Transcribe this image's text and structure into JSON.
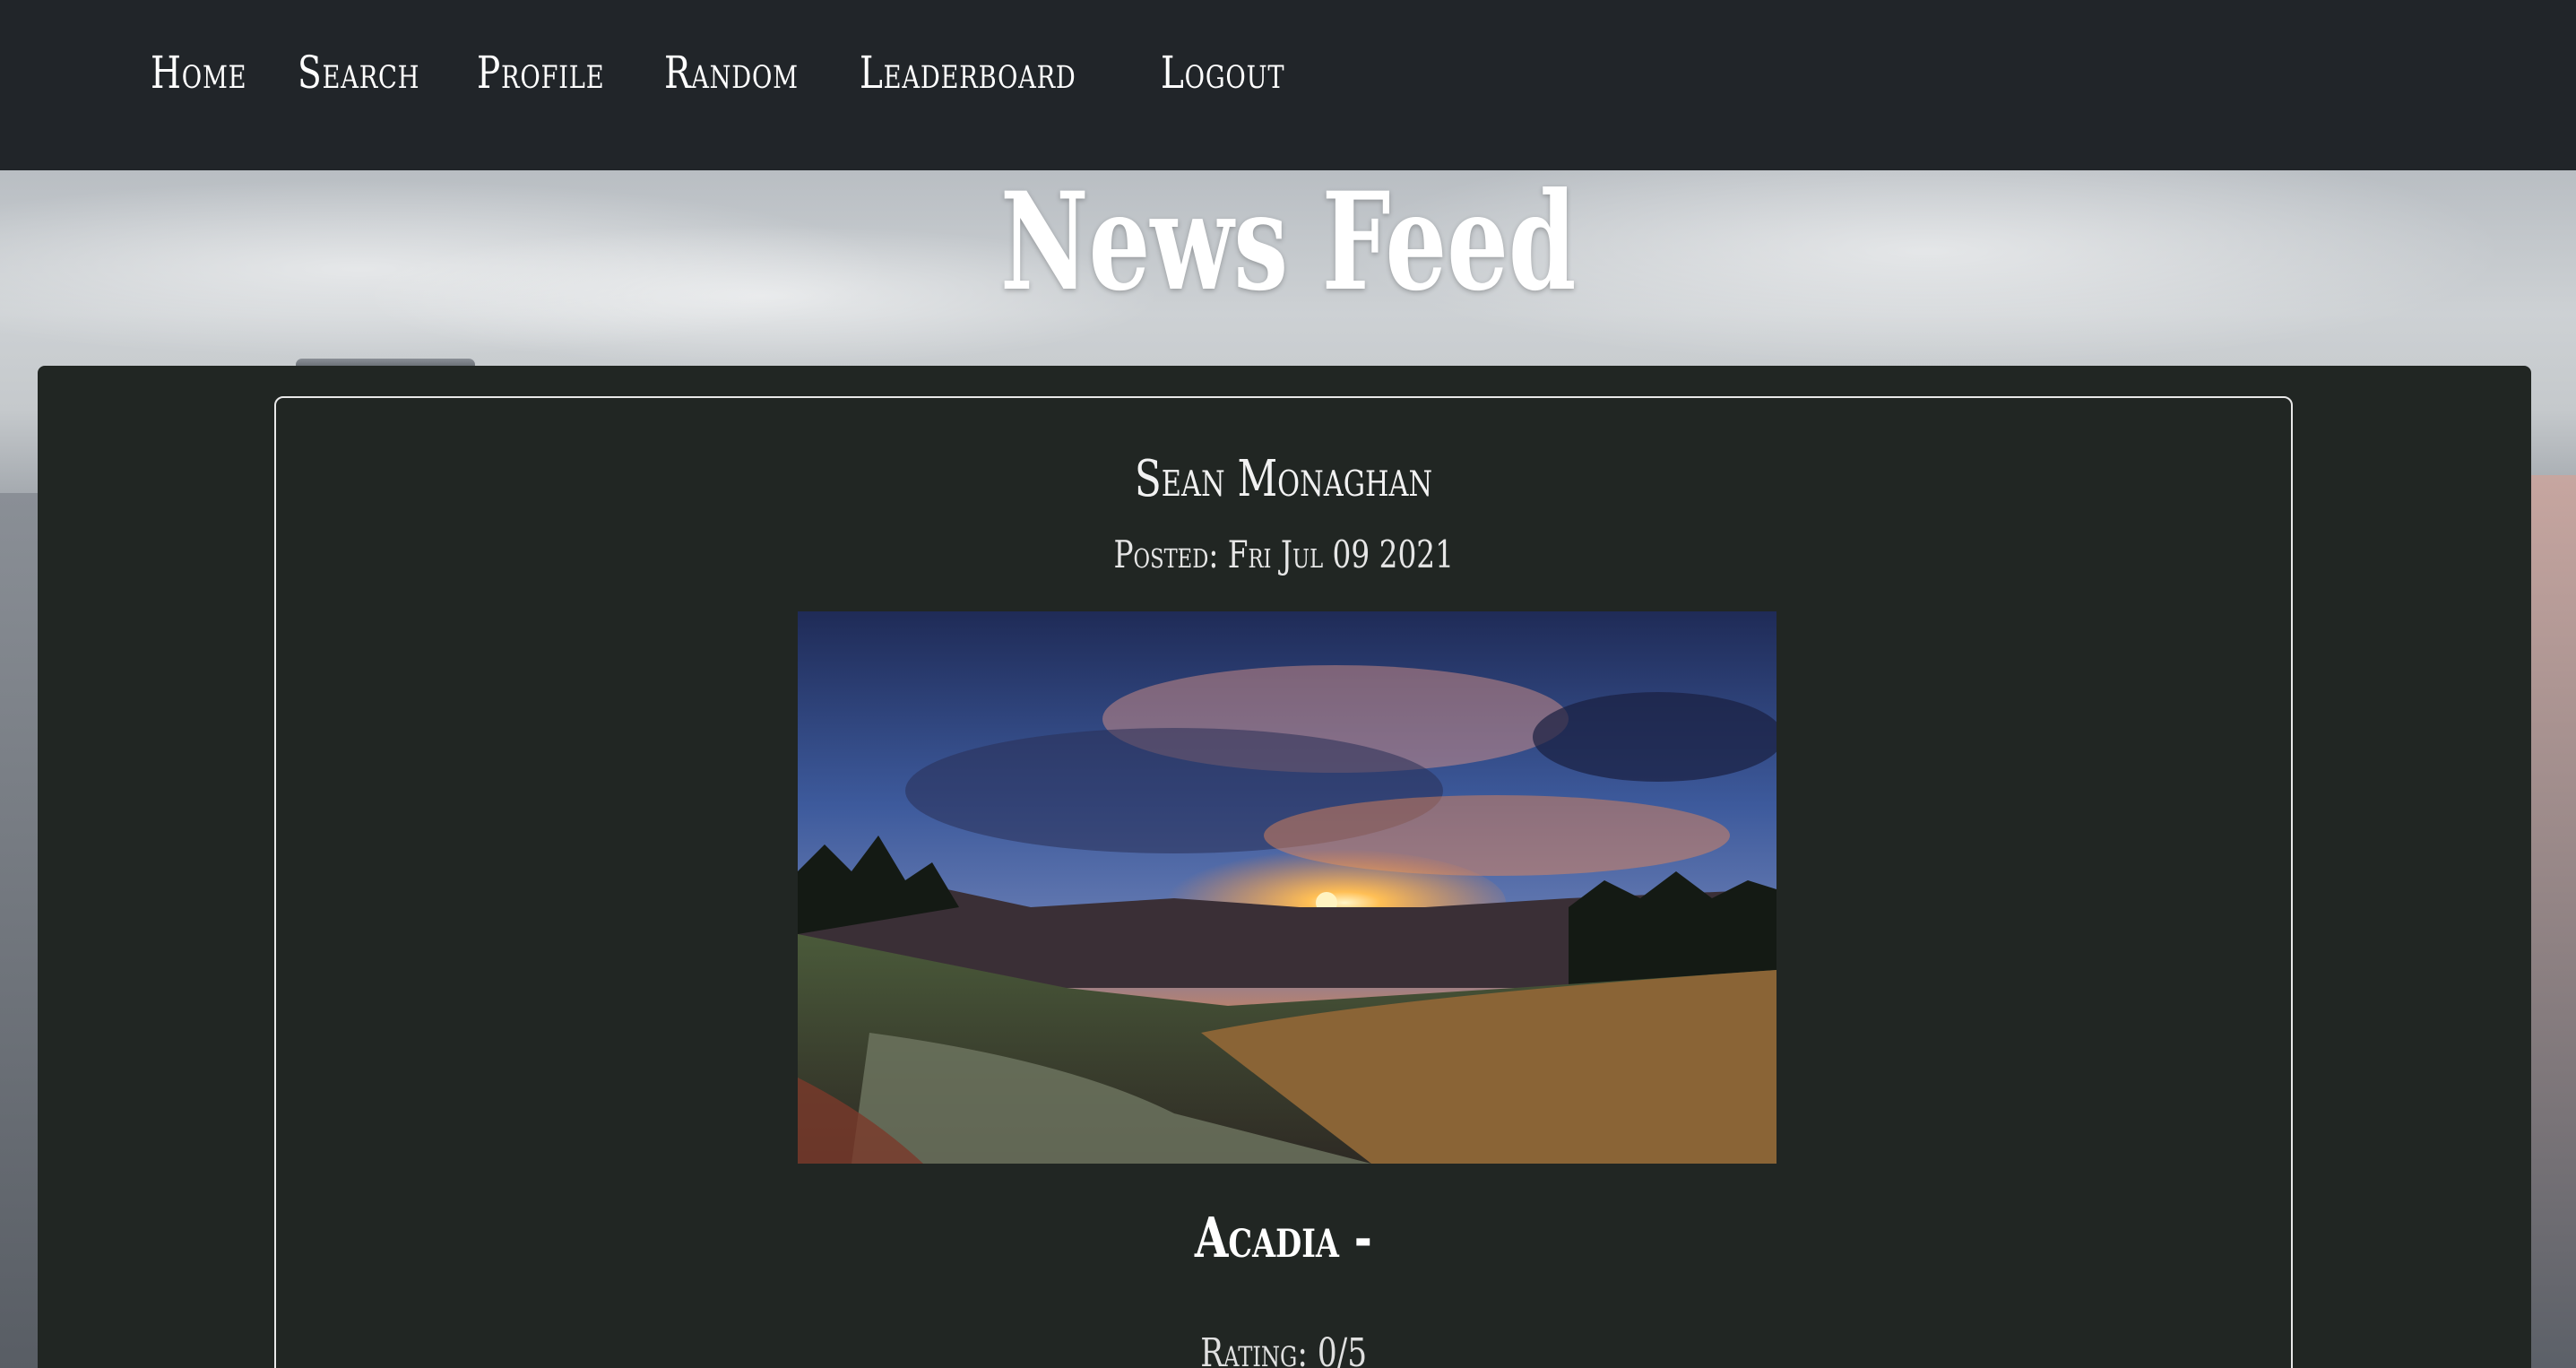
{
  "nav": {
    "items": [
      {
        "label": "Home"
      },
      {
        "label": "Search"
      },
      {
        "label": "Profile"
      },
      {
        "label": "Random"
      },
      {
        "label": "Leaderboard"
      },
      {
        "label": "Logout"
      }
    ]
  },
  "page": {
    "title": "News Feed"
  },
  "post": {
    "author": "Sean Monaghan",
    "posted": "Posted: Fri Jul 09 2021",
    "image_description_icon": "sunset-landscape-photo",
    "title": "Acadia -",
    "rating": "Rating: 0/5"
  },
  "colors": {
    "navbar": "#212529",
    "panel": "#212623",
    "text": "#ffffff"
  }
}
